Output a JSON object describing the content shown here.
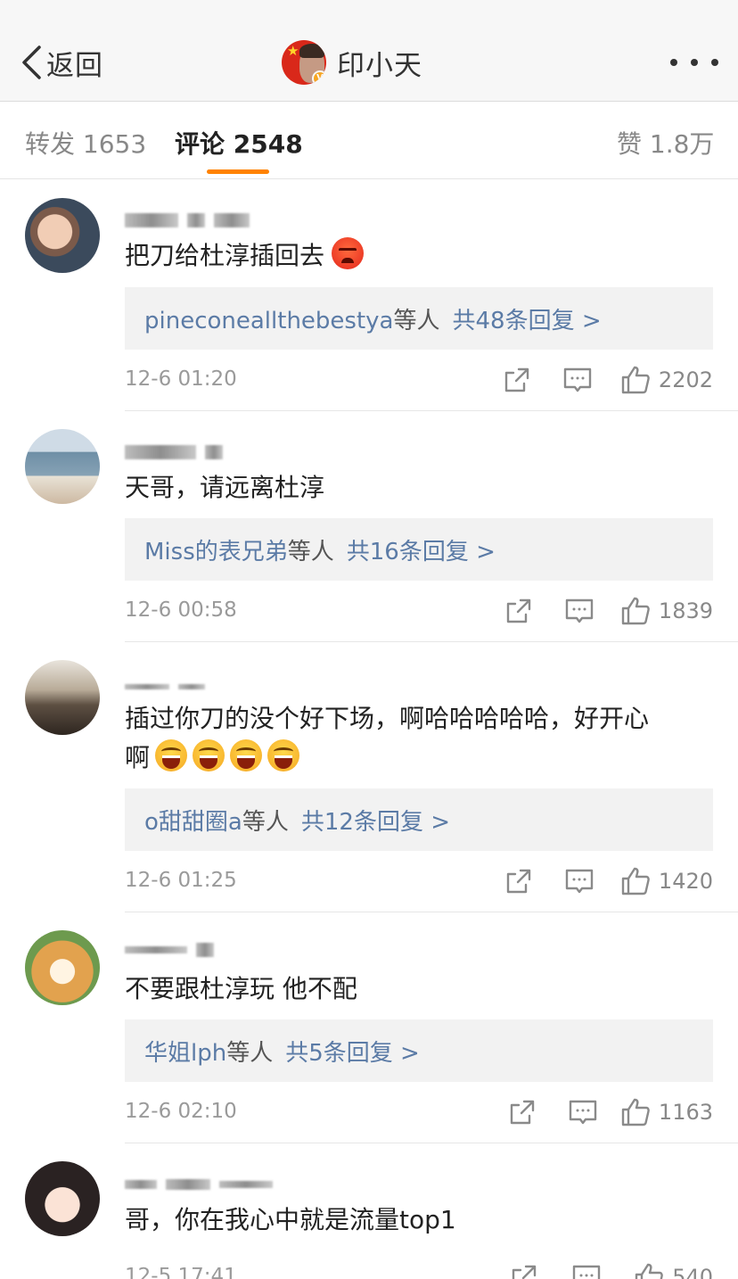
{
  "header": {
    "back_label": "返回",
    "title": "印小天"
  },
  "tabs": {
    "repost": "转发 1653",
    "comment": "评论 2548",
    "like": "赞 1.8万"
  },
  "comments": [
    {
      "text": "把刀给杜淳插回去",
      "reply_user": "pineconeallthebestya",
      "reply_mid": "等人",
      "reply_count": "共48条回复 >",
      "time": "12-6 01:20",
      "likes": "2202"
    },
    {
      "text": "天哥，请远离杜淳",
      "reply_user": "Miss的表兄弟",
      "reply_mid": "等人",
      "reply_count": "共16条回复 >",
      "time": "12-6 00:58",
      "likes": "1839"
    },
    {
      "text_line1": "插过你刀的没个好下场，啊哈哈哈哈哈，好开心",
      "text_line2": "啊",
      "reply_user": "o甜甜圈a",
      "reply_mid": "等人",
      "reply_count": "共12条回复 >",
      "time": "12-6 01:25",
      "likes": "1420"
    },
    {
      "text": "不要跟杜淳玩 他不配",
      "reply_user": "华姐lph",
      "reply_mid": "等人",
      "reply_count": "共5条回复 >",
      "time": "12-6 02:10",
      "likes": "1163"
    },
    {
      "text": "哥，你在我心中就是流量top1",
      "time": "12-5 17:41",
      "likes": "540"
    }
  ],
  "icons": {
    "back": "chevron-left-icon",
    "more": "more-dots-icon",
    "share": "share-icon",
    "reply": "comment-icon",
    "like": "thumbs-up-icon",
    "verified": "verified-badge-icon"
  },
  "colors": {
    "accent": "#ff8200",
    "link": "#5b7ba6",
    "secondary_text": "#9a9a9a"
  }
}
